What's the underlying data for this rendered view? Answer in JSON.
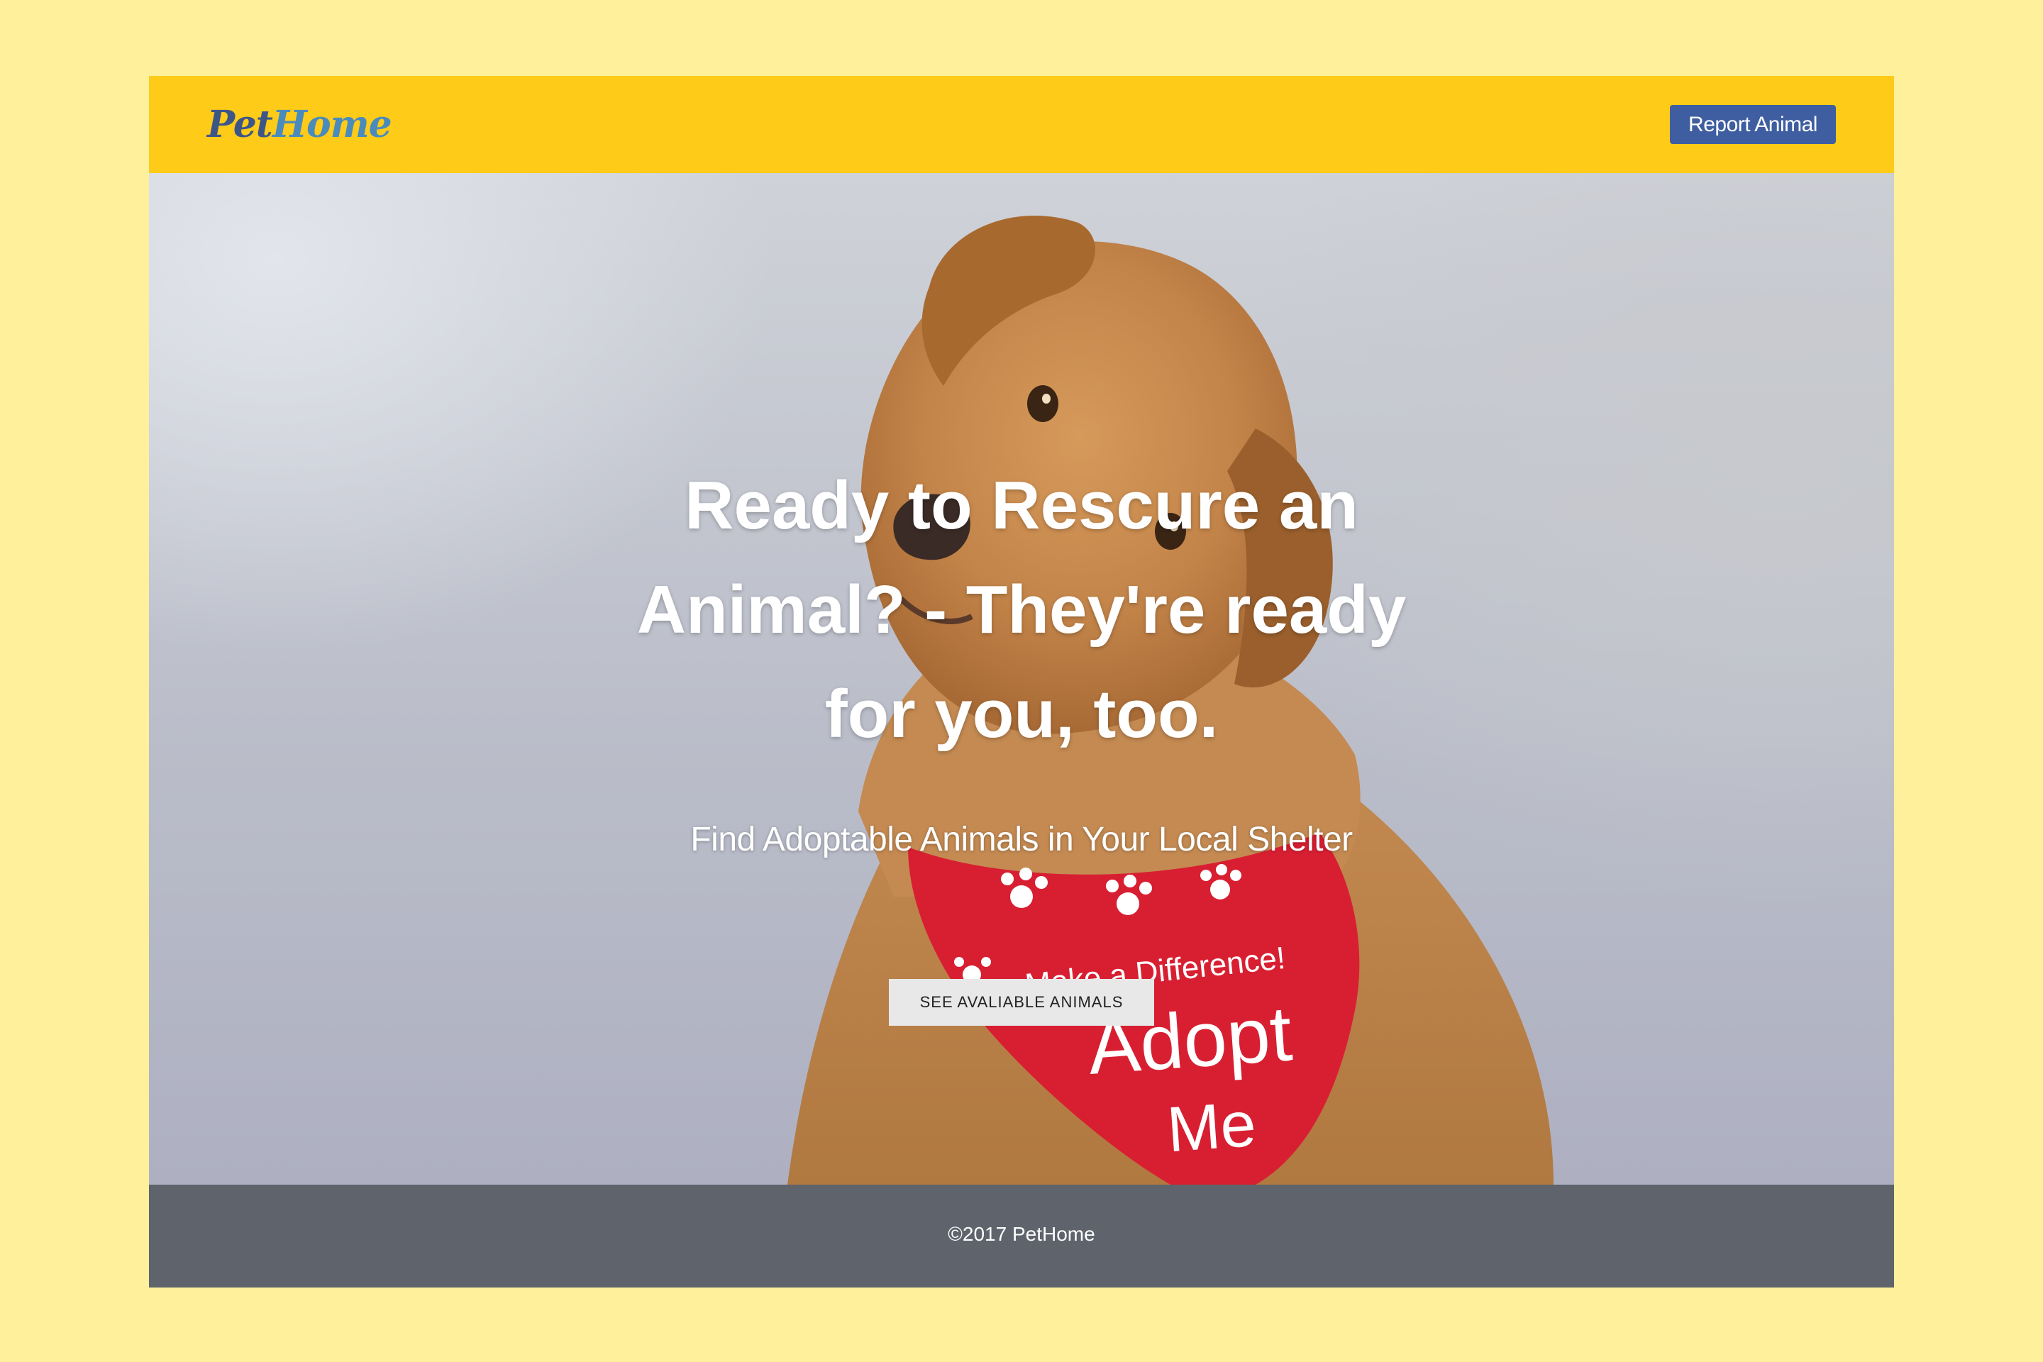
{
  "header": {
    "logo_part1": "Pet",
    "logo_part2": "Home",
    "report_button_label": "Report Animal"
  },
  "hero": {
    "title": "Ready to Rescure an Animal? - They're ready for you, too.",
    "subtitle": "Find Adoptable Animals in Your Local Shelter",
    "cta_label": "SEE AVALIABLE ANIMALS",
    "bandana_text_line1": "Make a Difference!",
    "bandana_text_line2": "Adopt",
    "bandana_text_line3": "Me"
  },
  "footer": {
    "copyright": "©2017 PetHome"
  },
  "colors": {
    "page_background": "#fff09c",
    "header_background": "#fecb18",
    "button_primary": "#3f5ea1",
    "footer_background": "#5f636b",
    "bandana_red": "#d81f32",
    "dog_fur": "#c98a4e"
  }
}
